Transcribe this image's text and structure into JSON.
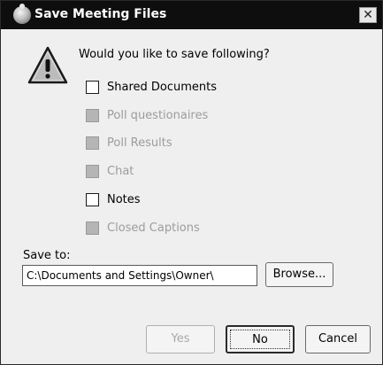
{
  "window": {
    "title": "Save Meeting Files",
    "close_glyph": "✕"
  },
  "icons": {
    "title": "app-globe-icon",
    "warning": "warning-icon",
    "close": "close-icon"
  },
  "dialog": {
    "question": "Would you like to save following?",
    "options": [
      {
        "label": "Shared Documents",
        "checked": false,
        "enabled": true
      },
      {
        "label": "Poll questionaires",
        "checked": false,
        "enabled": false
      },
      {
        "label": "Poll Results",
        "checked": false,
        "enabled": false
      },
      {
        "label": "Chat",
        "checked": false,
        "enabled": false
      },
      {
        "label": "Notes",
        "checked": false,
        "enabled": true
      },
      {
        "label": "Closed Captions",
        "checked": false,
        "enabled": false
      }
    ],
    "save_to_label": "Save to:",
    "save_path": "C:\\Documents and Settings\\Owner\\",
    "browse_label": "Browse...",
    "yes_label": "Yes",
    "no_label": "No",
    "cancel_label": "Cancel"
  },
  "colors": {
    "titlebar": "#0e0e0e",
    "dialog_bg": "#efefef",
    "disabled_text": "#9c9c9c"
  }
}
